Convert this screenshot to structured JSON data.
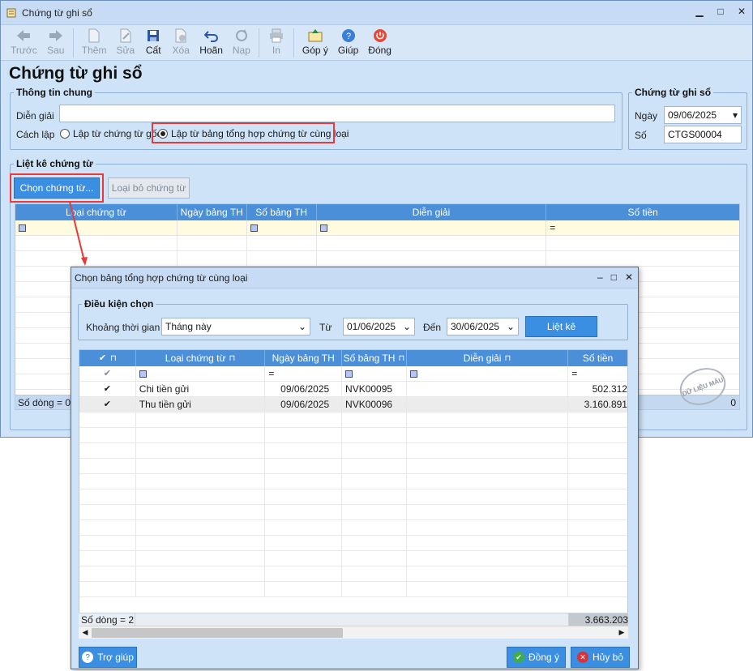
{
  "window": {
    "title": "Chứng từ ghi sổ"
  },
  "toolbar": {
    "truoc": "Trước",
    "sau": "Sau",
    "them": "Thêm",
    "sua": "Sửa",
    "cat": "Cất",
    "xoa": "Xóa",
    "hoan": "Hoãn",
    "nap": "Nạp",
    "in": "In",
    "gopy": "Góp ý",
    "giup": "Giúp",
    "dong": "Đóng"
  },
  "page_title": "Chứng từ ghi sổ",
  "general": {
    "legend": "Thông tin chung",
    "dien_giai_label": "Diễn giải",
    "dien_giai_value": "",
    "cach_lap_label": "Cách lập",
    "radio1": "Lập từ chứng từ gốc",
    "radio2": "Lập từ bảng tổng hợp chứng từ cùng loại"
  },
  "voucher": {
    "legend": "Chứng từ ghi sổ",
    "ngay_label": "Ngày",
    "ngay_value": "09/06/2025",
    "so_label": "Số",
    "so_value": "CTGS00004"
  },
  "list": {
    "legend": "Liệt kê chứng từ",
    "btn_chon": "Chọn chứng từ...",
    "btn_loai": "Loại bỏ chứng từ",
    "columns": [
      "Loại chứng từ",
      "Ngày bảng TH",
      "Số bảng TH",
      "Diễn giải",
      "Số tiền"
    ],
    "footer": "Số dòng = 0",
    "footer_total": "0"
  },
  "stamp": "DỮ LIỆU MẪU",
  "dialog": {
    "title": "Chọn bảng tổng hợp chứng từ cùng loại",
    "cond_legend": "Điều kiện chọn",
    "khoang_label": "Khoảng thời gian",
    "khoang_value": "Tháng này",
    "tu_label": "Từ",
    "tu_value": "01/06/2025",
    "den_label": "Đến",
    "den_value": "30/06/2025",
    "btn_lietke": "Liệt kê",
    "columns": [
      "Loại chứng từ",
      "Ngày bảng TH",
      "Số bảng TH",
      "Diễn giải",
      "Số tiền"
    ],
    "rows": [
      {
        "loai": "Chi tiền gửi",
        "ngay": "09/06/2025",
        "so": "NVK00095",
        "dien_giai": "",
        "so_tien": "502.312"
      },
      {
        "loai": "Thu tiền gửi",
        "ngay": "09/06/2025",
        "so": "NVK00096",
        "dien_giai": "",
        "so_tien": "3.160.891"
      }
    ],
    "footer": "Số dòng = 2",
    "footer_total": "3.663.203",
    "btn_help": "Trợ giúp",
    "btn_ok": "Đồng ý",
    "btn_cancel": "Hủy bỏ"
  }
}
